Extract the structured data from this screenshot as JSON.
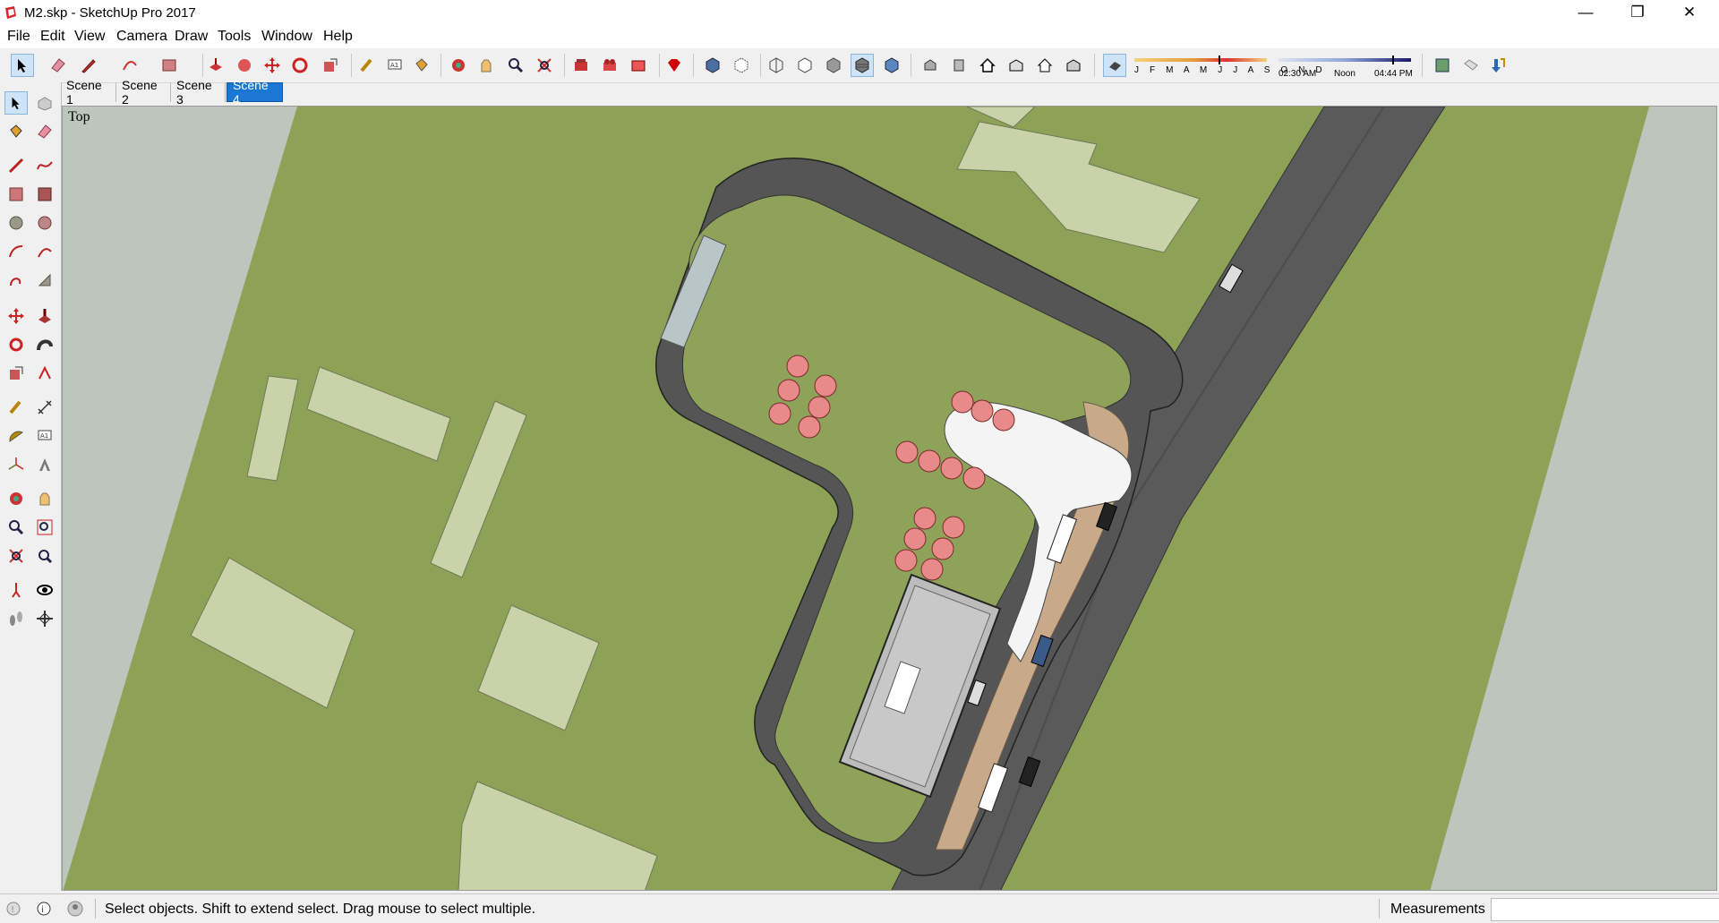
{
  "window": {
    "title": "M2.skp - SketchUp Pro 2017",
    "minimize": "—",
    "restore": "❐",
    "close": "✕"
  },
  "menu": [
    "File",
    "Edit",
    "View",
    "Camera",
    "Draw",
    "Tools",
    "Window",
    "Help"
  ],
  "toolbar": {
    "shadow_months": "J F M A M J J A S O N D",
    "time_start": "02:30 AM",
    "time_mid": "Noon",
    "time_end": "04:44 PM",
    "icons": [
      "select-icon",
      "eraser-icon",
      "pencil-icon",
      "arc-icon",
      "rectangle-icon",
      "push-pull-icon",
      "follow-me-icon",
      "move-icon",
      "rotate-icon",
      "scale-icon",
      "tape-measure-icon",
      "text-icon",
      "paint-bucket-icon",
      "orbit-icon",
      "pan-icon",
      "zoom-icon",
      "zoom-extents-icon",
      "warehouse-icon",
      "components-icon",
      "extension-icon",
      "ruby-icon",
      "xray-icon",
      "back-edges-icon",
      "wireframe-icon",
      "hidden-line-icon",
      "shaded-icon",
      "shaded-textures-icon",
      "monochrome-icon",
      "iso-view-icon",
      "top-view-icon",
      "front-view-icon",
      "right-view-icon",
      "back-view-icon",
      "left-view-icon",
      "shadows-toggle-icon",
      "styles-icon",
      "tag-icon",
      "layers-icon"
    ]
  },
  "scenes": [
    {
      "label": "Scene 1",
      "active": false
    },
    {
      "label": "Scene 2",
      "active": false
    },
    {
      "label": "Scene 3",
      "active": false
    },
    {
      "label": "Scene 4",
      "active": true
    }
  ],
  "viewport": {
    "camera_label": "Top"
  },
  "status": {
    "message": "Select objects. Shift to extend select. Drag mouse to select multiple.",
    "measurements_label": "Measurements",
    "measurements_value": ""
  },
  "colors": {
    "grass": "#8da157",
    "road": "#5a5a5a",
    "building": "#c9d2a8",
    "umbrella": "#e98a8a",
    "accent": "#1b77d2"
  }
}
